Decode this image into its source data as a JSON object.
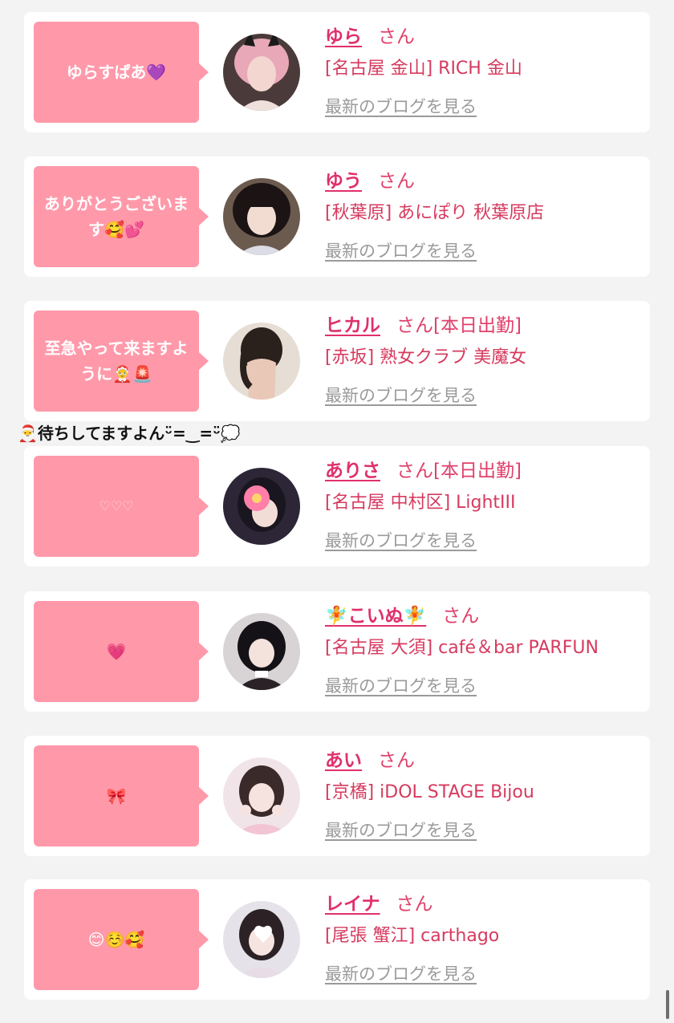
{
  "items": [
    {
      "message": "ゆらすぱあ💜",
      "name": "ゆら",
      "san": "さん",
      "status": "",
      "shop": "[名古屋 金山] RICH 金山",
      "blog_link": "最新のブログを見る"
    },
    {
      "message": "ありがとうございます🥰💕",
      "name": "ゆう",
      "san": "さん",
      "status": "",
      "shop": "[秋葉原] あにぽり 秋葉原店",
      "blog_link": "最新のブログを見る"
    },
    {
      "message": "至急やって来ますように🤶🚨",
      "name": "ヒカル",
      "san": "さん",
      "status": "[本日出勤]",
      "shop": "[赤坂] 熟女クラブ 美魔女",
      "blog_link": "最新のブログを見る"
    },
    {
      "message": "♡♡♡",
      "name": "ありさ",
      "san": "さん",
      "status": "[本日出勤]",
      "shop": "[名古屋 中村区] LightIII",
      "blog_link": "最新のブログを見る"
    },
    {
      "message": "💗",
      "name": "🧚こいぬ🧚",
      "san": "さん",
      "status": "",
      "shop": "[名古屋 大須] café＆bar PARFUN",
      "blog_link": "最新のブログを見る"
    },
    {
      "message": "🎀",
      "name": "あい",
      "san": "さん",
      "status": "",
      "shop": "[京橋] iDOL STAGE Bijou",
      "blog_link": "最新のブログを見る"
    },
    {
      "message": "😊☺️🥰",
      "name": "レイナ",
      "san": "さん",
      "status": "",
      "shop": "[尾張 蟹江] carthago",
      "blog_link": "最新のブログを見る"
    }
  ],
  "overflow_message": "🎅待ちしてますよんᵕ̈=‿=ᵕ̈💭",
  "colors": {
    "bubble": "#ff99aa",
    "name": "#e0306a",
    "shop": "#d63a5e",
    "blog_link": "#9a9a9a",
    "background": "#f3f3f3"
  }
}
